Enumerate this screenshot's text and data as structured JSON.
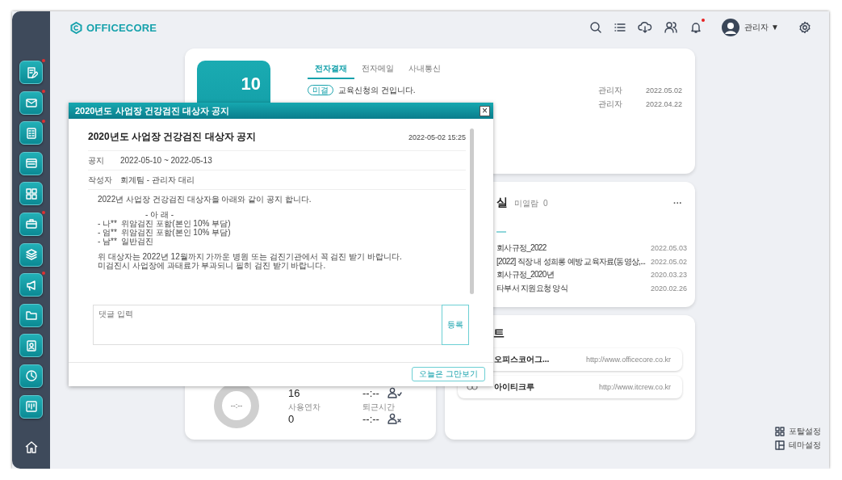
{
  "header": {
    "logo": "OFFICECORE",
    "user": "관리자 ▼",
    "notification": true
  },
  "sidebar": {
    "items": [
      {
        "badge": true
      },
      {
        "badge": true
      },
      {
        "badge": true
      },
      {
        "badge": false
      },
      {
        "badge": false
      },
      {
        "badge": true
      },
      {
        "badge": false
      },
      {
        "badge": true
      },
      {
        "badge": false
      },
      {
        "badge": false
      },
      {
        "badge": false
      },
      {
        "badge": false
      }
    ]
  },
  "approval": {
    "count": "10",
    "tabs": [
      {
        "label": "전자결재",
        "selected": true
      },
      {
        "label": "전자메일",
        "selected": false
      },
      {
        "label": "사내통신",
        "selected": false
      }
    ],
    "rows": [
      {
        "status": "미결",
        "title": "교육신청의 건입니다.",
        "author": "관리자",
        "date": "2022.05.02"
      },
      {
        "author": "관리자",
        "date": "2022.04.22"
      }
    ]
  },
  "archive": {
    "title": "실",
    "unread_label": "미열람",
    "unread_count": "0",
    "more": "···",
    "rows": [
      {
        "title": "회사규정_2022",
        "date": "2022.05.03"
      },
      {
        "title": "[2022] 직장 내 성희롱 예방 교육자료(동영상,...",
        "date": "2022.05.02"
      },
      {
        "title": "회사규정_2020년",
        "date": "2020.03.23"
      },
      {
        "title": "타부서 지원요청 양식",
        "date": "2020.02.26"
      }
    ]
  },
  "sites": {
    "title": "트",
    "links": [
      {
        "icon": false,
        "name": "오피스코어그...",
        "url": "http://www.officecore.co.kr"
      },
      {
        "icon": true,
        "name": "아이티크루",
        "url": "http://www.itcrew.co.kr"
      }
    ]
  },
  "attendance": {
    "chart_label": "--:--",
    "stats": [
      {
        "value": "16"
      },
      {
        "label": "사용연차",
        "value": "0"
      }
    ],
    "times": [
      {
        "value": "--:--",
        "kind": "check"
      },
      {
        "label": "퇴근시간",
        "value": "--:--",
        "kind": "cross"
      }
    ]
  },
  "settings": [
    {
      "label": "포탈설정"
    },
    {
      "label": "테마설정"
    }
  ],
  "modal": {
    "title": "2020년도 사업장 건강검진 대상자 공지",
    "close": "×",
    "heading": "2020년도 사업장 건강검진 대상자 공지",
    "date": "2022-05-02 15:25",
    "fields": [
      {
        "label": "공지",
        "value": "2022-05-10 ~ 2022-05-13"
      },
      {
        "label": "작성자",
        "value": "회계팀 - 관리자 대리"
      }
    ],
    "content": [
      {
        "kind": "line",
        "text": "2022년 사업장 건강검진 대상자을 아래와 같이 공지 합니다."
      },
      {
        "kind": "blank"
      },
      {
        "kind": "centered",
        "text": "- 아 래 -"
      },
      {
        "kind": "line",
        "text": "- 나**  위암검진 포함(본인 10% 부담)"
      },
      {
        "kind": "line",
        "text": "- 엄**  위암검진 포함(본인 10% 부담)"
      },
      {
        "kind": "line",
        "text": "- 남**  일반검진"
      },
      {
        "kind": "blank"
      },
      {
        "kind": "line",
        "text": "위 대상자는 2022년 12월까지 가까운 병원 또는 검진기관에서 꼭 검진 받기 바랍니다."
      },
      {
        "kind": "line",
        "text": "미검진시 사업장에 과태료가 부과되니 필히 검진 받기 바랍니다."
      }
    ],
    "comment": {
      "placeholder": "댓글 입력"
    },
    "submit": "등록",
    "dismiss": "오늘은 그만보기"
  }
}
